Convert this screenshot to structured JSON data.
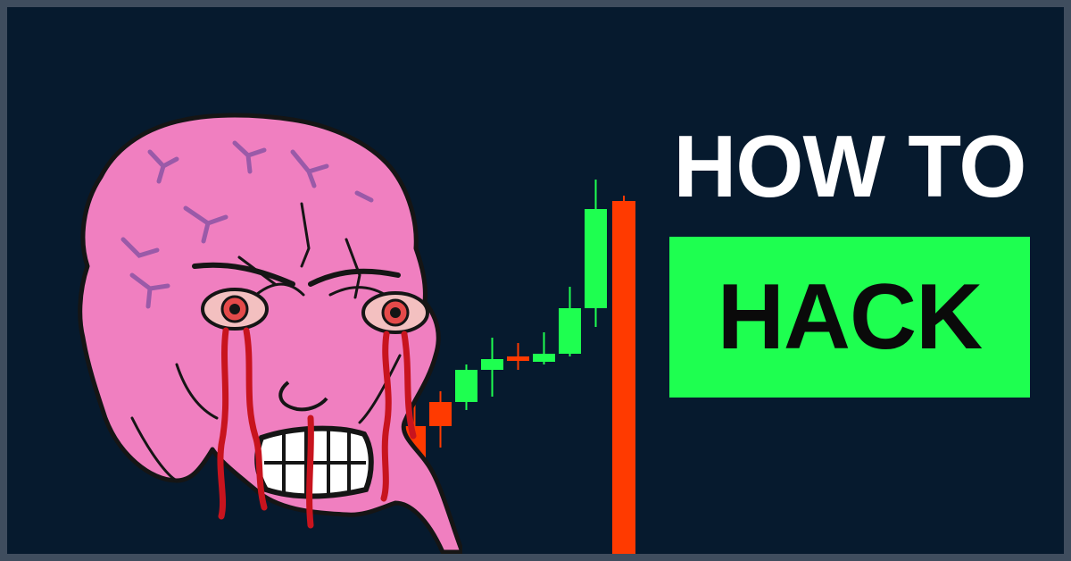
{
  "headline": {
    "line1": "HOW TO",
    "line2": "HACK"
  },
  "colors": {
    "background": "#061a2e",
    "frame": "#3f4d5e",
    "highlight_box": "#1eff50",
    "candle_up": "#1eff50",
    "candle_down": "#ff3a00",
    "face_skin": "#f080c0"
  },
  "illustration": {
    "character": "enraged-wojak-face-icon",
    "chart": "candlestick-chart-icon"
  },
  "candles": [
    {
      "open": 22,
      "close": 0,
      "high": 32,
      "low": -4
    },
    {
      "open": 31,
      "close": 22,
      "high": 35,
      "low": 14
    },
    {
      "open": 31,
      "close": 43,
      "high": 45,
      "low": 28
    },
    {
      "open": 43,
      "close": 47,
      "high": 55,
      "low": 33
    },
    {
      "open": 48,
      "close": 47,
      "high": 53,
      "low": 43
    },
    {
      "open": 46,
      "close": 49,
      "high": 57,
      "low": 45
    },
    {
      "open": 49,
      "close": 66,
      "high": 74,
      "low": 48
    },
    {
      "open": 66,
      "close": 103,
      "high": 114,
      "low": 59
    },
    {
      "open": 106,
      "close": -50,
      "high": 108,
      "low": -50
    }
  ]
}
